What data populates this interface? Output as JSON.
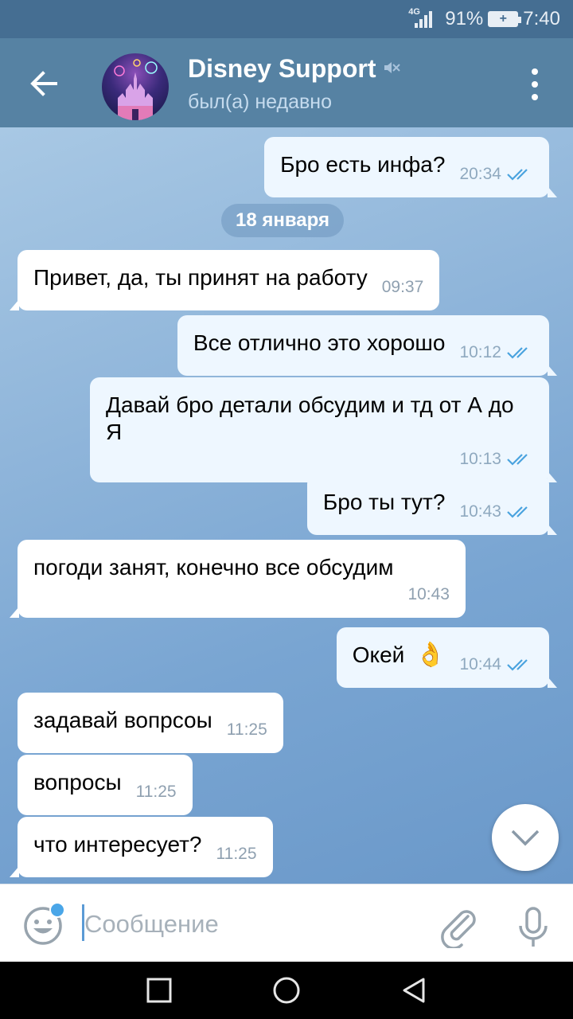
{
  "status_bar": {
    "network": "4G",
    "battery": "91%",
    "time": "7:40"
  },
  "header": {
    "title": "Disney Support",
    "subtitle": "был(а) недавно",
    "avatar_icon": "castle-fireworks-avatar",
    "muted_icon": "muted-speaker-icon",
    "accent": "#5682a3"
  },
  "chat": {
    "date_pill": "18 января",
    "messages": [
      {
        "dir": "out",
        "text": "Бро есть инфа?",
        "time": "20:34",
        "read": true
      },
      {
        "dir": "in",
        "text": "Привет, да, ты принят на работу",
        "time": "09:37"
      },
      {
        "dir": "out",
        "text": "Все отлично это хорошо",
        "time": "10:12",
        "read": true
      },
      {
        "dir": "out",
        "text": "Давай бро детали обсудим и тд от А до Я",
        "time": "10:13",
        "read": true
      },
      {
        "dir": "out",
        "text": "Бро ты тут?",
        "time": "10:43",
        "read": true
      },
      {
        "dir": "in",
        "text": "погоди занят, конечно все обсудим",
        "time": "10:43"
      },
      {
        "dir": "out",
        "text": "Окей",
        "emoji": "👌",
        "time": "10:44",
        "read": true
      },
      {
        "dir": "in",
        "text": "задавай вопрсоы",
        "time": "11:25"
      },
      {
        "dir": "in",
        "text": "вопросы",
        "time": "11:25"
      },
      {
        "dir": "in",
        "text": "что интересует?",
        "time": "11:25"
      }
    ]
  },
  "input": {
    "placeholder": "Сообщение",
    "value": ""
  },
  "colors": {
    "incoming_bubble": "#ffffff",
    "outgoing_bubble": "#eef7ff",
    "read_check": "#4aa3df",
    "status_bar": "#456e92"
  }
}
